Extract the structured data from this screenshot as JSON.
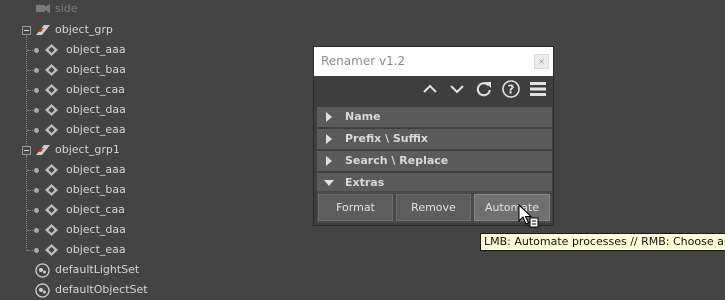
{
  "outliner": {
    "rows": [
      {
        "label": "side",
        "icon": "camera-icon",
        "dim": true
      },
      {
        "label": "object_grp",
        "icon": "group-icon"
      },
      {
        "label": "object_aaa",
        "icon": "locator-icon"
      },
      {
        "label": "object_baa",
        "icon": "locator-icon"
      },
      {
        "label": "object_caa",
        "icon": "locator-icon"
      },
      {
        "label": "object_daa",
        "icon": "locator-icon"
      },
      {
        "label": "object_eaa",
        "icon": "locator-icon"
      },
      {
        "label": "object_grp1",
        "icon": "group-icon"
      },
      {
        "label": "object_aaa",
        "icon": "locator-icon"
      },
      {
        "label": "object_baa",
        "icon": "locator-icon"
      },
      {
        "label": "object_caa",
        "icon": "locator-icon"
      },
      {
        "label": "object_daa",
        "icon": "locator-icon"
      },
      {
        "label": "object_eaa",
        "icon": "locator-icon"
      },
      {
        "label": "defaultLightSet",
        "icon": "set-icon"
      },
      {
        "label": "defaultObjectSet",
        "icon": "set-icon"
      }
    ]
  },
  "renamer": {
    "title": "Renamer v1.2",
    "close_glyph": "×",
    "toolbar": [
      "move-up-icon",
      "move-down-icon",
      "refresh-icon",
      "help-icon",
      "menu-icon"
    ],
    "sections": [
      {
        "label": "Name",
        "expanded": false
      },
      {
        "label": "Prefix \\ Suffix",
        "expanded": false
      },
      {
        "label": "Search \\ Replace",
        "expanded": false
      },
      {
        "label": "Extras",
        "expanded": true
      }
    ],
    "extras_buttons": [
      "Format",
      "Remove",
      "Automate"
    ]
  },
  "tooltip": {
    "text": "LMB: Automate processes // RMB: Choose auto"
  }
}
